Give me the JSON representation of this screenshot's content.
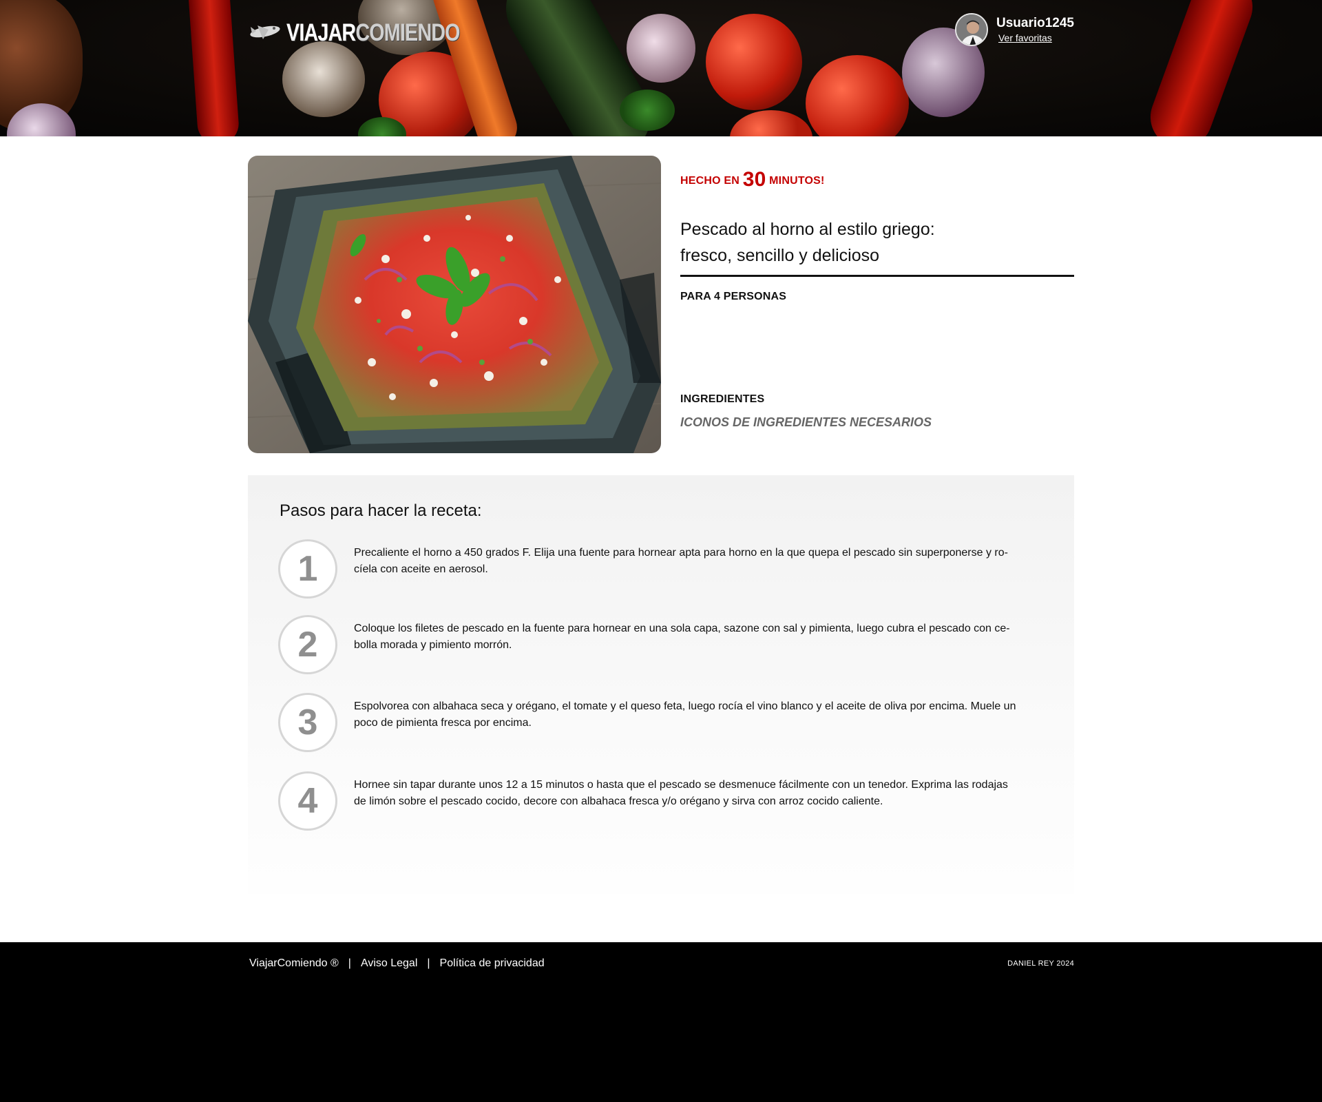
{
  "header": {
    "logo": {
      "part1": "VIAJAR",
      "part2": "COMIENDO"
    },
    "user": {
      "name": "Usuario1245",
      "favorites_link": "Ver favoritas"
    }
  },
  "recipe": {
    "time_prefix": "HECHO EN",
    "time_value": "30",
    "time_suffix": "MINUTOS!",
    "title_line1": "Pescado al horno al estilo griego:",
    "title_line2": "fresco, sencillo y delicioso",
    "servings": "PARA 4 PERSONAS",
    "ingredients_heading": "INGREDIENTES",
    "ingredients_icons": "ICONOS DE INGREDIENTES NECESARIOS"
  },
  "steps": {
    "title": "Pasos para hacer la receta:",
    "items": [
      {
        "number": "1",
        "text": "Precaliente el horno a 450 grados F. Elija una fuente para hornear apta para horno en la que quepa el pescado sin superponerse y ro-\ncíela con aceite en aerosol."
      },
      {
        "number": "2",
        "text": "Coloque los filetes de pescado en la fuente para hornear en una sola capa, sazone con sal y pimienta, luego cubra el pescado con ce-\nbolla morada y pimiento morrón."
      },
      {
        "number": "3",
        "text": "Espolvorea con albahaca seca y orégano, el tomate y el queso feta, luego rocía el vino blanco y el aceite de oliva por encima. Muele un\npoco de pimienta fresca por encima."
      },
      {
        "number": "4",
        "text": "Hornee sin tapar durante unos 12 a 15 minutos o hasta que el pescado se desmenuce fácilmente con un tenedor. Exprima las rodajas\nde limón sobre el pescado cocido, decore con albahaca fresca y/o orégano y sirva con arroz cocido caliente."
      }
    ]
  },
  "footer": {
    "brand": "ViajarComiendo ®",
    "separator": "|",
    "legal": "Aviso Legal",
    "privacy": "Política de privacidad",
    "credit": "DANIEL REY 2024"
  },
  "colors": {
    "accent_red": "#c40000",
    "steps_background": "#f2f2f2",
    "footer_background": "#000000"
  },
  "icons": [
    "airplane-icon",
    "avatar",
    "food-photo"
  ]
}
